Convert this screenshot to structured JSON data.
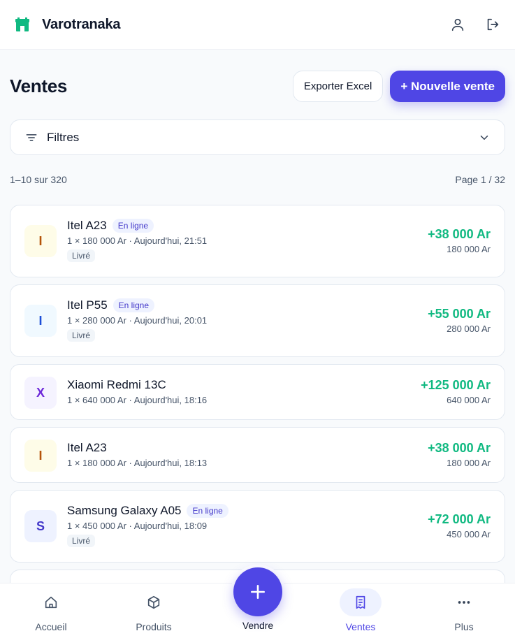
{
  "app": {
    "name": "Varotranaka",
    "brand_color": "#10b981",
    "accent_color": "#4f46e5"
  },
  "header": {
    "icons": [
      "user-icon",
      "logout-icon"
    ]
  },
  "page": {
    "title": "Ventes",
    "export_label": "Exporter Excel",
    "new_sale_label": "+ Nouvelle vente"
  },
  "filters": {
    "label": "Filtres"
  },
  "pagination": {
    "range": "1–10 sur 320",
    "page": "Page 1 / 32"
  },
  "sales": [
    {
      "initial": "I",
      "name": "Itel A23",
      "channel": "En ligne",
      "detail": "1 × 180 000 Ar · Aujourd'hui, 21:51",
      "status": "Livré",
      "amount": "+38 000 Ar",
      "price": "180 000 Ar",
      "avatar_bg": "#fefce8",
      "avatar_fg": "#b45309"
    },
    {
      "initial": "I",
      "name": "Itel P55",
      "channel": "En ligne",
      "detail": "1 × 280 000 Ar · Aujourd'hui, 20:01",
      "status": "Livré",
      "amount": "+55 000 Ar",
      "price": "280 000 Ar",
      "avatar_bg": "#f0f9ff",
      "avatar_fg": "#1d4ed8"
    },
    {
      "initial": "X",
      "name": "Xiaomi Redmi 13C",
      "channel": "",
      "detail": "1 × 640 000 Ar · Aujourd'hui, 18:16",
      "status": "",
      "amount": "+125 000 Ar",
      "price": "640 000 Ar",
      "avatar_bg": "#f5f3ff",
      "avatar_fg": "#6d28d9"
    },
    {
      "initial": "I",
      "name": "Itel A23",
      "channel": "",
      "detail": "1 × 180 000 Ar · Aujourd'hui, 18:13",
      "status": "",
      "amount": "+38 000 Ar",
      "price": "180 000 Ar",
      "avatar_bg": "#fefce8",
      "avatar_fg": "#b45309"
    },
    {
      "initial": "S",
      "name": "Samsung Galaxy A05",
      "channel": "En ligne",
      "detail": "1 × 450 000 Ar · Aujourd'hui, 18:09",
      "status": "Livré",
      "amount": "+72 000 Ar",
      "price": "450 000 Ar",
      "avatar_bg": "#eef2ff",
      "avatar_fg": "#4338ca"
    }
  ],
  "nav": {
    "home": "Accueil",
    "products": "Produits",
    "sell": "Vendre",
    "sales": "Ventes",
    "more": "Plus"
  }
}
